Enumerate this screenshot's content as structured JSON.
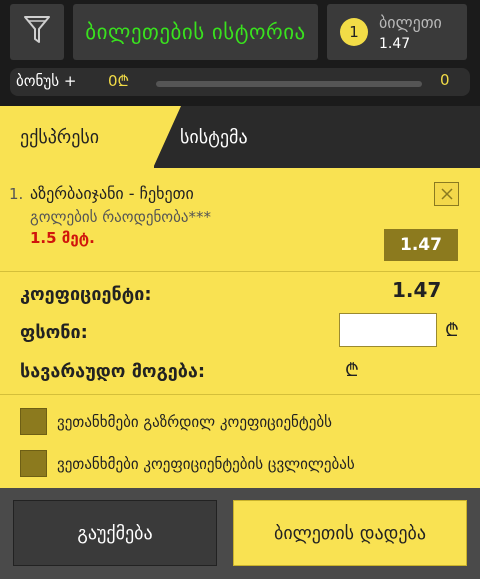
{
  "header": {
    "history_label": "ბილეთების ისტორია",
    "ticket": {
      "count": "1",
      "label": "ბილეთი",
      "value": "1.47"
    }
  },
  "bonus": {
    "label": "ბონუს +",
    "amount": "0₾",
    "count": "0",
    "progress": 0
  },
  "tabs": {
    "express": "ექსპრესი",
    "system": "სისტემა",
    "active": "express"
  },
  "bet": {
    "number": "1.",
    "match": "აზერბაიჯანი - ჩეხეთი",
    "market": "გოლების რაოდენობა***",
    "pick": "1.5 მეტ.",
    "odds": "1.47"
  },
  "summary": {
    "odds_label": "კოეფიციენტი:",
    "odds_value": "1.47",
    "stake_label": "ფსონი:",
    "stake_value": "",
    "currency": "₾",
    "win_label": "სავარაუდო მოგება:"
  },
  "options": [
    {
      "label": "ვეთანხმები გაზრდილ კოეფიციენტებს"
    },
    {
      "label": "ვეთანხმები კოეფიციენტების ცვლილებას"
    }
  ],
  "footer": {
    "cancel_label": "გაუქმება",
    "place_label": "ბილეთის დადება"
  },
  "colors": {
    "accent": "#f9e252",
    "history_text": "#39e21e",
    "pick_text": "#d0140c",
    "odds_badge": "#8c7a1e"
  }
}
